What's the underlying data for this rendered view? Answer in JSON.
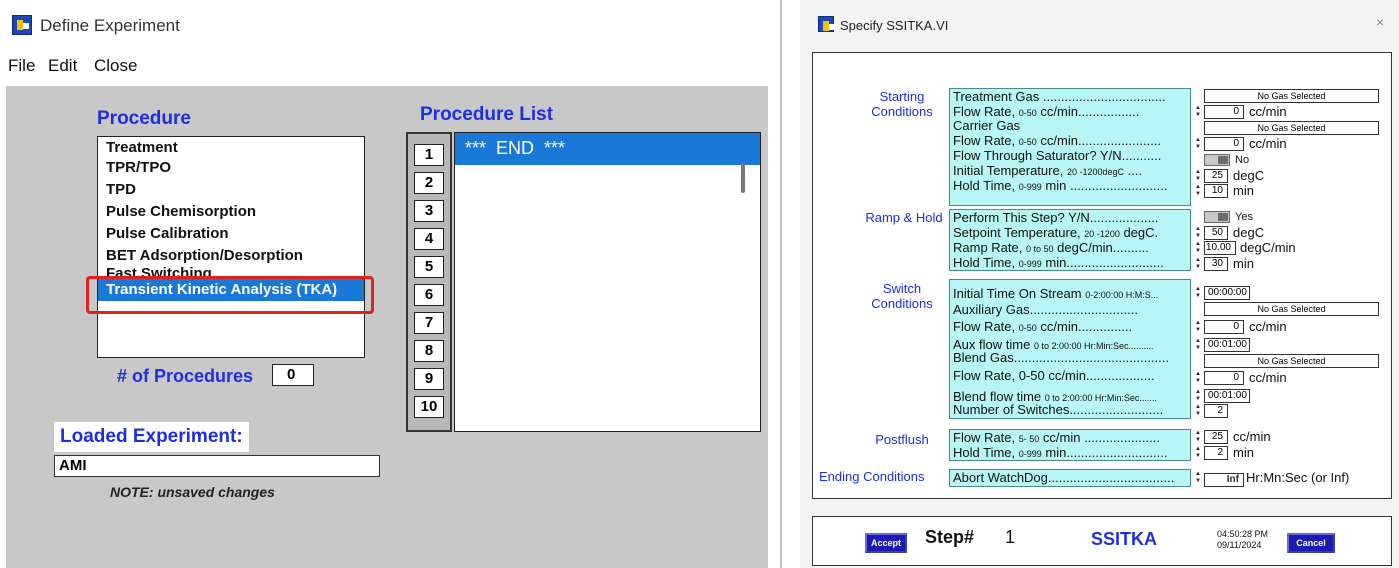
{
  "left_window": {
    "title": "Define Experiment",
    "menu": [
      "File",
      "Edit",
      "Close"
    ],
    "procedure_label": "Procedure",
    "procedures": [
      "Treatment",
      "TPR/TPO",
      "TPD",
      "Pulse Chemisorption",
      "Pulse Calibration",
      "BET Adsorption/Desorption",
      "Fast Switching",
      "Transient Kinetic Analysis (TKA)"
    ],
    "selected_procedure": "Transient Kinetic Analysis (TKA)",
    "num_procedures_label": "# of Procedures",
    "num_procedures_value": "0",
    "procedure_list_label": "Procedure List",
    "step_numbers": [
      "1",
      "2",
      "3",
      "4",
      "5",
      "6",
      "7",
      "8",
      "9",
      "10"
    ],
    "procedure_list_items": [
      "***  END  ***"
    ],
    "loaded_experiment_label": "Loaded Experiment:",
    "loaded_experiment_value": "AMI",
    "note": "NOTE: unsaved changes"
  },
  "right_window": {
    "title": "Specify SSITKA.VI",
    "close_glyph": "×",
    "sections": {
      "starting": "Starting\nConditions",
      "ramp": "Ramp & Hold",
      "switch": "Switch\nConditions",
      "postflush": "Postflush",
      "ending": "Ending Conditions"
    },
    "starting": {
      "treatment_gas_label": "Treatment Gas ..................................",
      "treatment_gas_value": "No Gas Selected",
      "flow_rate_label": "Flow Rate,",
      "flow_rate_range": "0-50",
      "flow_rate_unit_text": " cc/min.................",
      "flow_rate_value": "0",
      "carrier_gas_label": "Carrier Gas",
      "carrier_gas_value": "No Gas Selected",
      "flow_rate2_label": "Flow Rate,",
      "flow_rate2_range": "0-50",
      "flow_rate2_unit_text": " cc/min.......................",
      "flow_rate2_value": "0",
      "saturator_label": "Flow Through Saturator? Y/N...........",
      "saturator_value": "No",
      "init_temp_label": "Initial Temperature,",
      "init_temp_range": "20 -1200degC",
      "init_temp_dots": " ....",
      "init_temp_value": "25",
      "hold_label": "Hold Time,",
      "hold_range": "0-999",
      "hold_unit_text": " min ...........................",
      "hold_value": "10"
    },
    "ramp": {
      "perform_label": "Perform This Step? Y/N...................",
      "perform_value": "Yes",
      "setpoint_label": "Setpoint Temperature,",
      "setpoint_range": "20 -1200",
      "setpoint_unit_text": " degC.",
      "setpoint_value": "50",
      "ramp_rate_label": "Ramp Rate,",
      "ramp_rate_range": "0 to 50",
      "ramp_rate_unit_text": " degC/min..........",
      "ramp_rate_value": "10.00",
      "hold_label": "Hold Time,",
      "hold_range": "0-999",
      "hold_unit_text": " min...........................",
      "hold_value": "30"
    },
    "switch": {
      "init_time_label": "Initial Time On Stream",
      "init_time_range": "0-2:00:00 H:M:S...",
      "init_time_value": "00:00:00",
      "aux_gas_label": "Auxiliary  Gas..............................",
      "aux_gas_value": "No Gas Selected",
      "flow_rate_label": "Flow Rate,",
      "flow_rate_range": "0-50",
      "flow_rate_unit_text": " cc/min...............",
      "flow_rate_value": "0",
      "aux_flow_label": "Aux flow time",
      "aux_flow_range": "0 to 2:00:00 Hr:Min:Sec..........",
      "aux_flow_value": "00:01:00",
      "blend_gas_label": "Blend Gas...........................................",
      "blend_gas_value": "No Gas Selected",
      "flow_rate2_label": "Flow Rate,  0-50 cc/min...................",
      "flow_rate2_value": "0",
      "blend_flow_label": "Blend flow time",
      "blend_flow_range": "0 to 2:00:00 Hr:Min:Sec.......",
      "blend_flow_value": "00:01:00",
      "num_switches_label": "Number of Switches..........................",
      "num_switches_value": "2"
    },
    "postflush": {
      "flow_rate_label": "Flow Rate,",
      "flow_rate_range": "5- 50",
      "flow_rate_unit_text": "   cc/min .....................",
      "flow_rate_value": "25",
      "hold_label": "Hold Time,",
      "hold_range": "0-999",
      "hold_unit_text": " min............................",
      "hold_value": "2"
    },
    "ending": {
      "abort_label": "Abort WatchDog...................................",
      "abort_value": "Inf",
      "abort_unit": "Hr:Mn:Sec (or Inf)"
    },
    "units": {
      "cc_min": "cc/min",
      "degC": "degC",
      "degC_min": "degC/min",
      "min": "min"
    },
    "bottom": {
      "accept_label": "Accept",
      "step_label": "Step#",
      "step_value": "1",
      "title": "SSITKA",
      "time": "04:50:28 PM",
      "date": "09/11/2024",
      "cancel_label": "Cancel"
    }
  },
  "colors": {
    "accent_blue": "#1e2ee0",
    "selection_blue": "#1a78d8",
    "highlight_red": "#e2231a",
    "cyan_field": "#b7f6f4",
    "gray_panel": "#c8c8c8"
  }
}
